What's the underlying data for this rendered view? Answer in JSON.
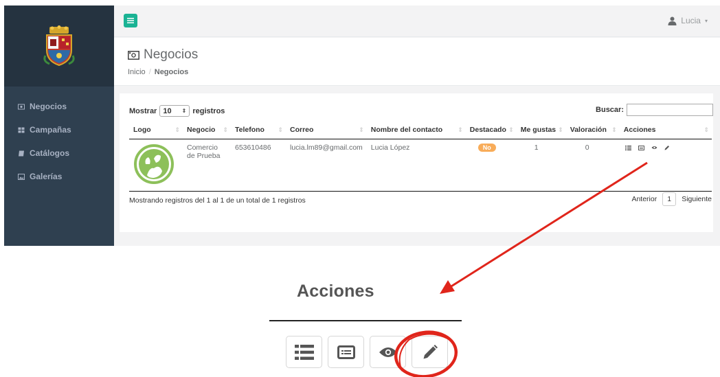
{
  "user": {
    "name": "Lucia"
  },
  "sidebar": {
    "items": [
      {
        "label": "Negocios",
        "icon": "money-icon"
      },
      {
        "label": "Campañas",
        "icon": "grid-icon"
      },
      {
        "label": "Catálogos",
        "icon": "book-icon"
      },
      {
        "label": "Galerías",
        "icon": "image-icon"
      }
    ]
  },
  "page": {
    "title": "Negocios",
    "breadcrumb": {
      "home": "Inicio",
      "separator": "/",
      "current": "Negocios"
    }
  },
  "table": {
    "show_label": "Mostrar",
    "page_size": "10",
    "records_label": "registros",
    "search_label": "Buscar:",
    "search_value": "",
    "columns": [
      "Logo",
      "Negocio",
      "Telefono",
      "Correo",
      "Nombre del contacto",
      "Destacado",
      "Me gustas",
      "Valoración",
      "Acciones"
    ],
    "rows": [
      {
        "negocio": "Comercio de Prueba",
        "telefono": "653610486",
        "correo": "lucia.lm89@gmail.com",
        "contacto": "Lucia López",
        "destacado": "No",
        "me_gustas": "1",
        "valoracion": "0"
      }
    ],
    "info": "Mostrando registros del 1 al 1 de un total de 1 registros",
    "pager": {
      "prev": "Anterior",
      "page": "1",
      "next": "Siguiente"
    }
  },
  "zoom": {
    "title": "Acciones",
    "buttons": [
      "list-icon",
      "card-icon",
      "eye-icon",
      "pencil-icon"
    ]
  },
  "colors": {
    "accent": "#1ab394",
    "sidebar": "#2f4050",
    "badge": "#f8ac59",
    "annotation": "#e0251b"
  }
}
